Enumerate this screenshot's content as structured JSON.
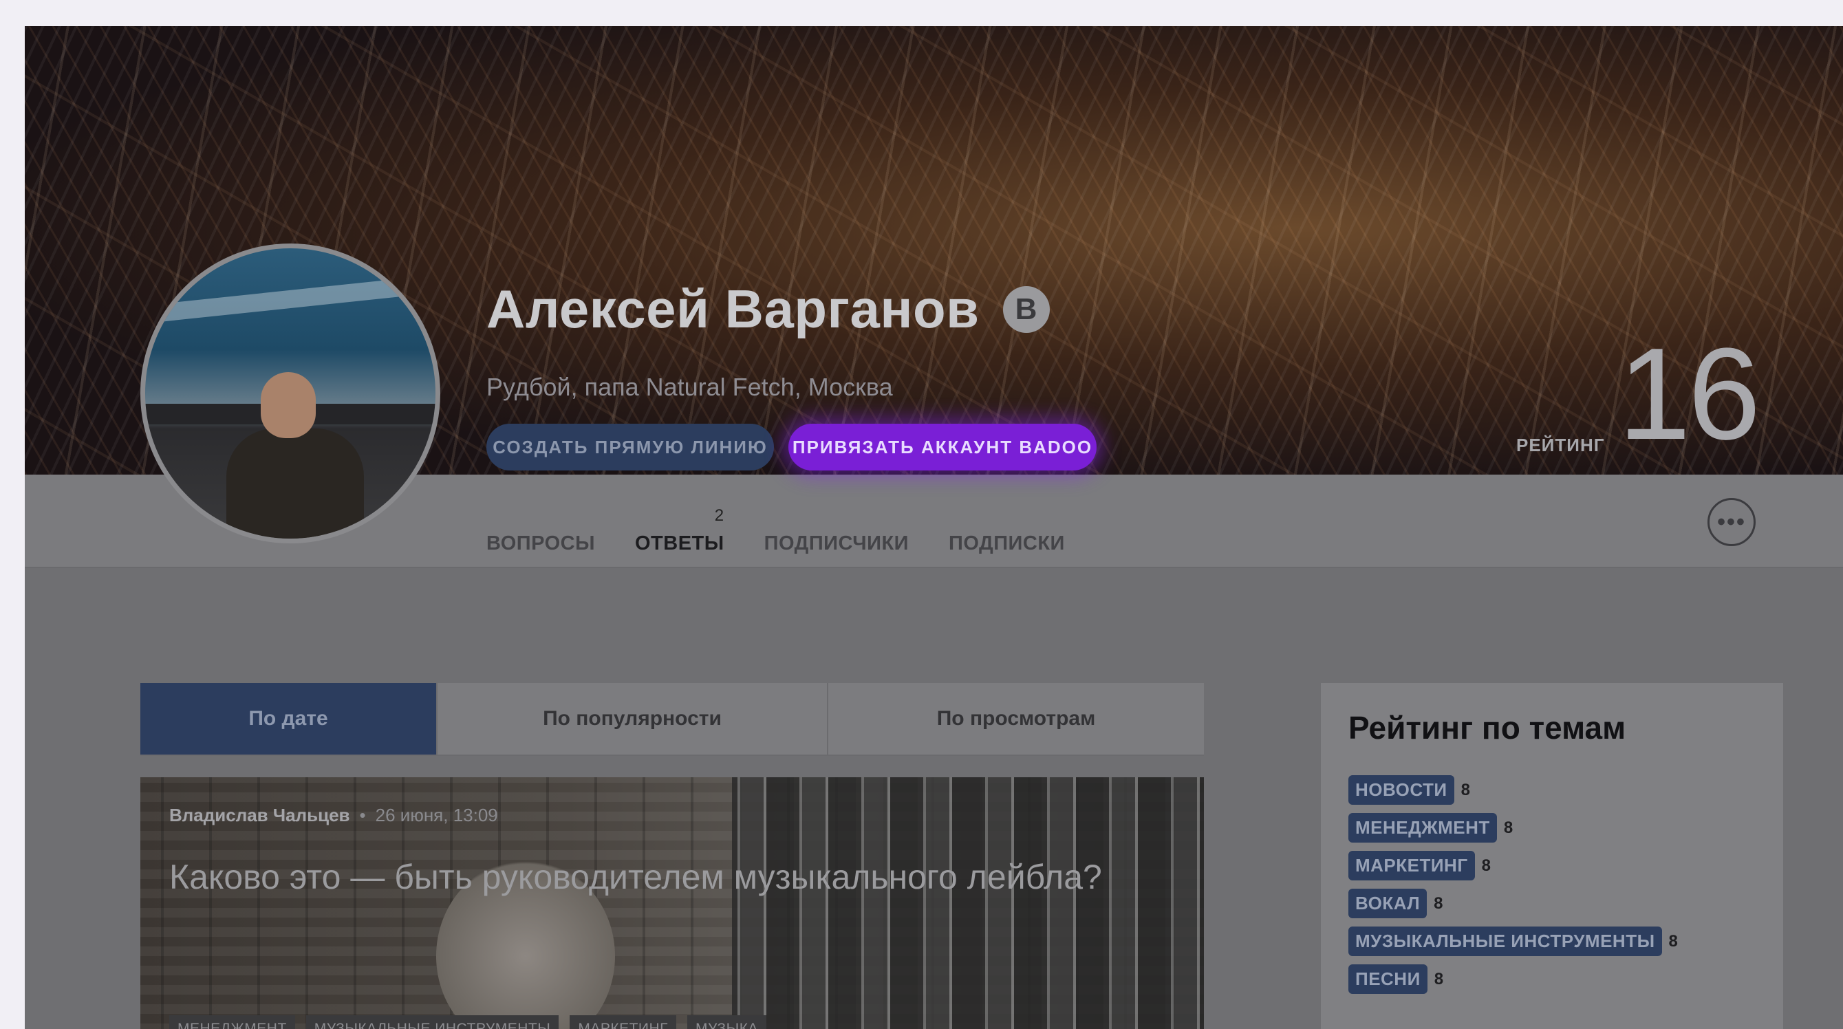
{
  "profile": {
    "name": "Алексей Варганов",
    "verified_badge": "B",
    "subtitle": "Рудбой, папа Natural Fetch, Москва",
    "buttons": {
      "direct_line": "СОЗДАТЬ ПРЯМУЮ ЛИНИЮ",
      "badoo": "ПРИВЯЗАТЬ АККАУНТ BADOO"
    },
    "rating_label": "РЕЙТИНГ",
    "rating_value": "16"
  },
  "nav": {
    "tabs": [
      {
        "label": "ВОПРОСЫ",
        "count": ""
      },
      {
        "label": "ОТВЕТЫ",
        "count": "2"
      },
      {
        "label": "ПОДПИСЧИКИ",
        "count": ""
      },
      {
        "label": "ПОДПИСКИ",
        "count": ""
      }
    ],
    "more_icon": "•••"
  },
  "sort": {
    "options": [
      "По дате",
      "По популярности",
      "По просмотрам"
    ],
    "selected": "По дате"
  },
  "article": {
    "author": "Владислав Чальцев",
    "separator": "•",
    "date": "26 июня, 13:09",
    "title": "Каково это — быть руководителем музыкального лейбла?",
    "tags": [
      "МЕНЕДЖМЕНТ",
      "МУЗЫКАЛЬНЫЕ ИНСТРУМЕНТЫ",
      "МАРКЕТИНГ",
      "МУЗЫКА"
    ]
  },
  "sidebar": {
    "title": "Рейтинг по темам",
    "topics": [
      {
        "label": "НОВОСТИ",
        "value": "8"
      },
      {
        "label": "МЕНЕДЖМЕНТ",
        "value": "8"
      },
      {
        "label": "МАРКЕТИНГ",
        "value": "8"
      },
      {
        "label": "ВОКАЛ",
        "value": "8"
      },
      {
        "label": "МУЗЫКАЛЬНЫЕ ИНСТРУМЕНТЫ",
        "value": "8"
      },
      {
        "label": "ПЕСНИ",
        "value": "8"
      }
    ]
  },
  "colors": {
    "accent_blue": "#2c3d5e",
    "badoo_purple": "#7a1fd6",
    "overlay_gray": "#6f6f72"
  }
}
